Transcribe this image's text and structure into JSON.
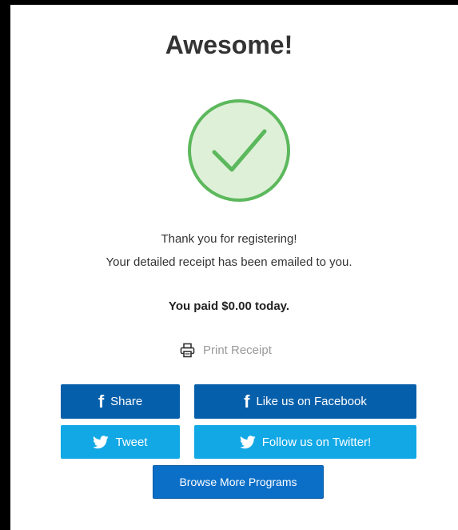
{
  "title": "Awesome!",
  "message": {
    "line1": "Thank you for registering!",
    "line2": "Your detailed receipt has been emailed to you."
  },
  "payment": {
    "summary": "You paid $0.00 today."
  },
  "print": {
    "label": "Print Receipt",
    "icon": "printer-icon"
  },
  "social": {
    "share_label": "Share",
    "like_label": "Like us on Facebook",
    "tweet_label": "Tweet",
    "follow_label": "Follow us on Twitter!",
    "facebook_glyph": "f",
    "facebook_icon": "facebook-icon",
    "twitter_icon": "twitter-icon"
  },
  "browse": {
    "label": "Browse More Programs"
  },
  "colors": {
    "success_green": "#5cb85c",
    "success_fill": "#dff0d8",
    "facebook_blue": "#065faa",
    "twitter_blue": "#11a8e5",
    "primary_blue": "#0b6fc8"
  }
}
